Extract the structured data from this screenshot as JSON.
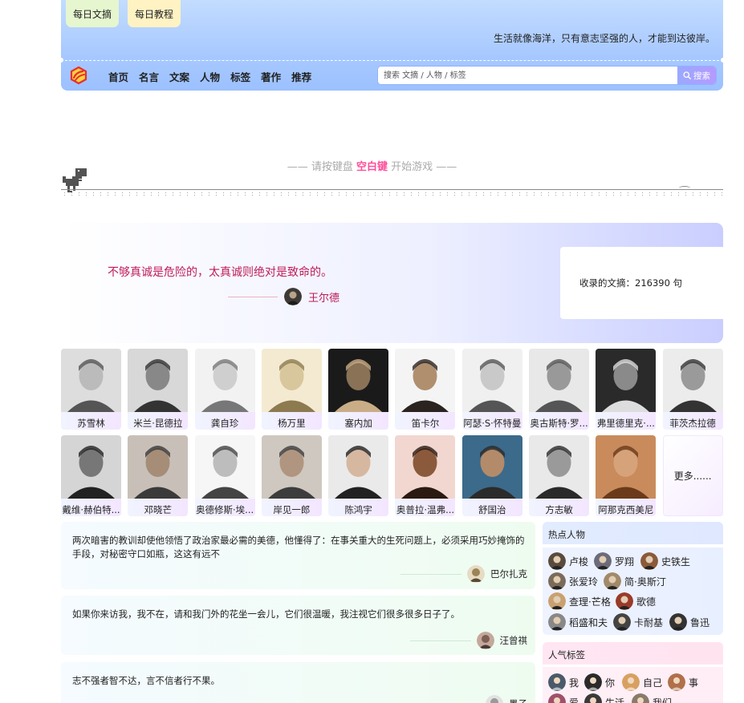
{
  "header": {
    "top_tags": [
      "每日文摘",
      "每日教程"
    ],
    "slogan": "生活就像海洋，只有意志坚强的人，才能到达彼岸。",
    "nav": [
      "首页",
      "名言",
      "文案",
      "人物",
      "标签",
      "著作",
      "推荐"
    ],
    "search": {
      "placeholder": "搜索 文摘 / 人物 / 标签",
      "button": "搜索"
    }
  },
  "game": {
    "hint_prefix": "—— 请按键盘 ",
    "hint_key": "空白键",
    "hint_suffix": " 开始游戏 ——"
  },
  "featured": {
    "quote": "不够真诚是危险的，太真诚则绝对是致命的。",
    "author": "王尔德",
    "count_text": "收录的文摘：216390 句"
  },
  "people": [
    "苏雪林",
    "米兰·昆德拉",
    "龚自珍",
    "杨万里",
    "塞内加",
    "笛卡尔",
    "阿瑟·S·怀特曼",
    "奥古斯特·罗...",
    "弗里德里克·...",
    "菲茨杰拉德",
    "戴维·赫伯特...",
    "邓晓芒",
    "奥德修斯·埃...",
    "岸见一郎",
    "陈鸿宇",
    "奥普拉·温弗...",
    "舒国治",
    "方志敏",
    "阿那克西美尼"
  ],
  "more_label": "更多......",
  "quotes": [
    {
      "text": "两次暗害的教训却使他领悟了政治家最必需的美德，他懂得了：在事关重大的生死问题上，必须采用巧妙掩饰的手段，对秘密守口如瓶，这这有远不",
      "author": "巴尔扎克"
    },
    {
      "text": "如果你来访我，我不在，请和我门外的花坐一会儿，它们很温暖，我注视它们很多很多日子了。",
      "author": "汪曾祺"
    },
    {
      "text": "志不强者智不达，言不信者行不果。",
      "author": "墨子"
    }
  ],
  "sidebar": {
    "hot_title": "热点人物",
    "hot_people": [
      "卢梭",
      "罗翔",
      "史铁生",
      "张爱玲",
      "简·奥斯汀",
      "查理·芒格",
      "歌德",
      "稻盛和夫",
      "卡耐基",
      "鲁迅"
    ],
    "tag_title": "人气标签",
    "tags": [
      "我",
      "你",
      "自己",
      "事",
      "爱",
      "生活",
      "我们"
    ]
  },
  "colors": {
    "accent_pink": "#c01a5a",
    "key_pink": "#ff4d9a",
    "header_blue": "#a8c9ff"
  }
}
